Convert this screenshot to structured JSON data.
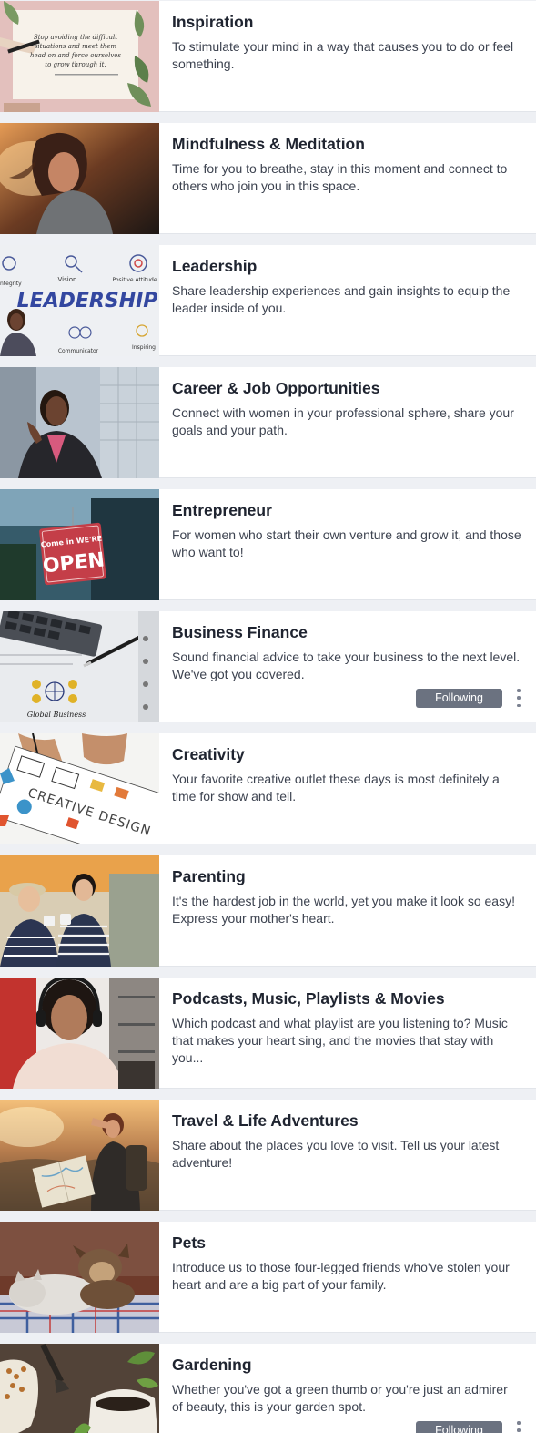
{
  "categories": [
    {
      "title": "Inspiration",
      "description": "To stimulate your mind in a way that causes you to do or feel something.",
      "image_text": "Stop avoiding the difficult situations and meet them head on and force ourselves to grow through it."
    },
    {
      "title": "Mindfulness & Meditation",
      "description": "Time for you to breathe, stay in this moment and connect to others who join you in this space."
    },
    {
      "title": "Leadership",
      "description": "Share leadership experiences and gain insights to equip the leader inside of you.",
      "image_text": "LEADERSHIP",
      "image_words": [
        "Vision",
        "Positive Attitude",
        "ntegrity",
        "Inspiring",
        "Communicator"
      ]
    },
    {
      "title": "Career & Job Opportunities",
      "description": "Connect with women in your professional sphere, share your goals and your path."
    },
    {
      "title": "Entrepreneur",
      "description": "For women who start their own venture and grow it, and those who want to!",
      "image_text": "OPEN",
      "image_small_text": "Come in WE'RE"
    },
    {
      "title": "Business Finance",
      "description": "Sound financial advice to take your business to the next level. We've got you covered.",
      "following_label": "Following",
      "image_text": "Global Business"
    },
    {
      "title": "Creativity",
      "description": "Your favorite creative outlet these days is most definitely a time for show and tell.",
      "image_text": "CREATIVE DESIGN"
    },
    {
      "title": "Parenting",
      "description": "It's the hardest job in the world, yet you make it look so easy! Express your mother's heart."
    },
    {
      "title": "Podcasts, Music, Playlists & Movies",
      "description": "Which podcast and what playlist are you listening to? Music that makes your heart sing, and the movies that stay with you..."
    },
    {
      "title": "Travel & Life Adventures",
      "description": "Share about the places you love to visit. Tell us your latest adventure!"
    },
    {
      "title": "Pets",
      "description": "Introduce us to those four-legged friends who've stolen your heart and are a big part of your family."
    },
    {
      "title": "Gardening",
      "description": "Whether you've got a green thumb or you're just an admirer of beauty, this is your garden spot.",
      "following_label": "Following"
    }
  ]
}
